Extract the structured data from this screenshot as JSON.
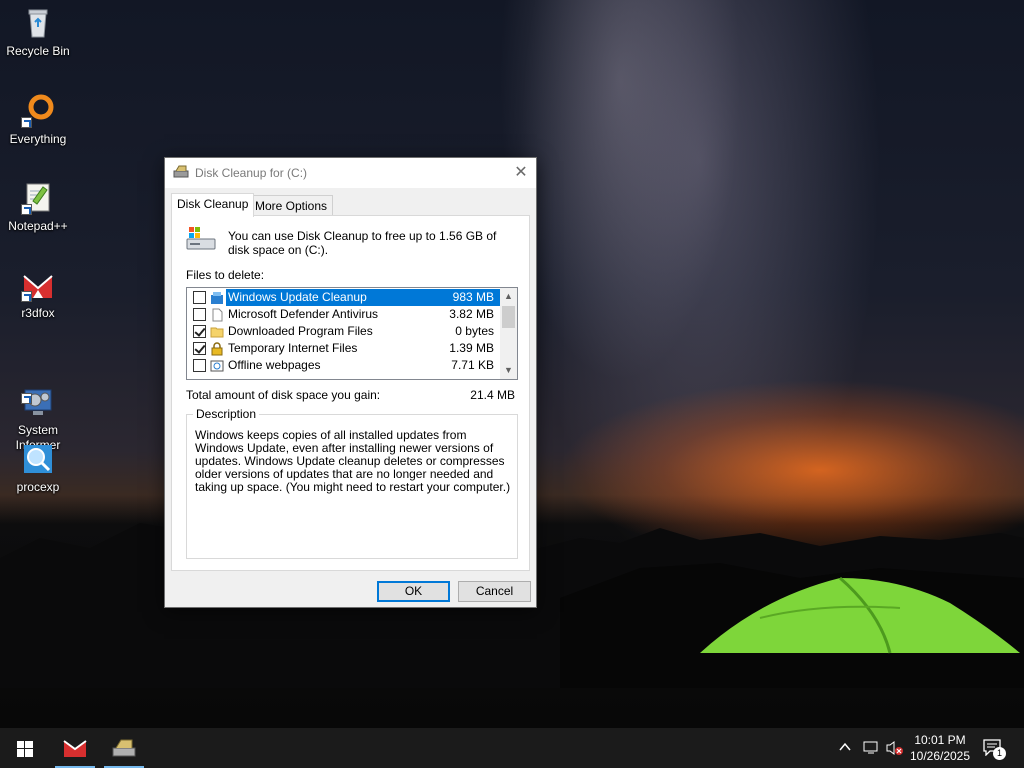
{
  "desktop": {
    "icons": [
      {
        "label": "Recycle Bin",
        "icon": "recycle-bin-icon"
      },
      {
        "label": "Everything",
        "icon": "everything-search-icon"
      },
      {
        "label": "Notepad++",
        "icon": "notepad-plus-plus-icon"
      },
      {
        "label": "r3dfox",
        "icon": "r3dfox-browser-icon"
      },
      {
        "label": "System\nInformer",
        "icon": "system-informer-icon"
      },
      {
        "label": "procexp",
        "icon": "process-explorer-icon"
      }
    ]
  },
  "dialog": {
    "title": "Disk Cleanup for  (C:)",
    "tabs": [
      {
        "label": "Disk Cleanup",
        "active": true
      },
      {
        "label": "More Options",
        "active": false
      }
    ],
    "intro": "You can use Disk Cleanup to free up to 1.56 GB of disk space on  (C:).",
    "files_label": "Files to delete:",
    "files": [
      {
        "name": "Windows Update Cleanup",
        "size": "983 MB",
        "checked": false,
        "selected": true,
        "icon": "windows-update-icon"
      },
      {
        "name": "Microsoft Defender Antivirus",
        "size": "3.82 MB",
        "checked": false,
        "selected": false,
        "icon": "blank-file-icon"
      },
      {
        "name": "Downloaded Program Files",
        "size": "0 bytes",
        "checked": true,
        "selected": false,
        "icon": "folder-icon"
      },
      {
        "name": "Temporary Internet Files",
        "size": "1.39 MB",
        "checked": true,
        "selected": false,
        "icon": "lock-icon"
      },
      {
        "name": "Offline webpages",
        "size": "7.71 KB",
        "checked": false,
        "selected": false,
        "icon": "offline-webpage-icon"
      }
    ],
    "total_label": "Total amount of disk space you gain:",
    "total_value": "21.4 MB",
    "description_legend": "Description",
    "description_text": "Windows keeps copies of all installed updates from Windows Update, even after installing newer versions of updates. Windows Update cleanup deletes or compresses older versions of updates that are no longer needed and taking up space. (You might need to restart your computer.)",
    "ok_label": "OK",
    "cancel_label": "Cancel"
  },
  "taskbar": {
    "time": "10:01 PM",
    "date": "10/26/2025",
    "notification_count": "1"
  },
  "colors": {
    "selection": "#0078d7",
    "taskbar": "#1b1b1b",
    "dialog_bg": "#f0f0f0"
  }
}
